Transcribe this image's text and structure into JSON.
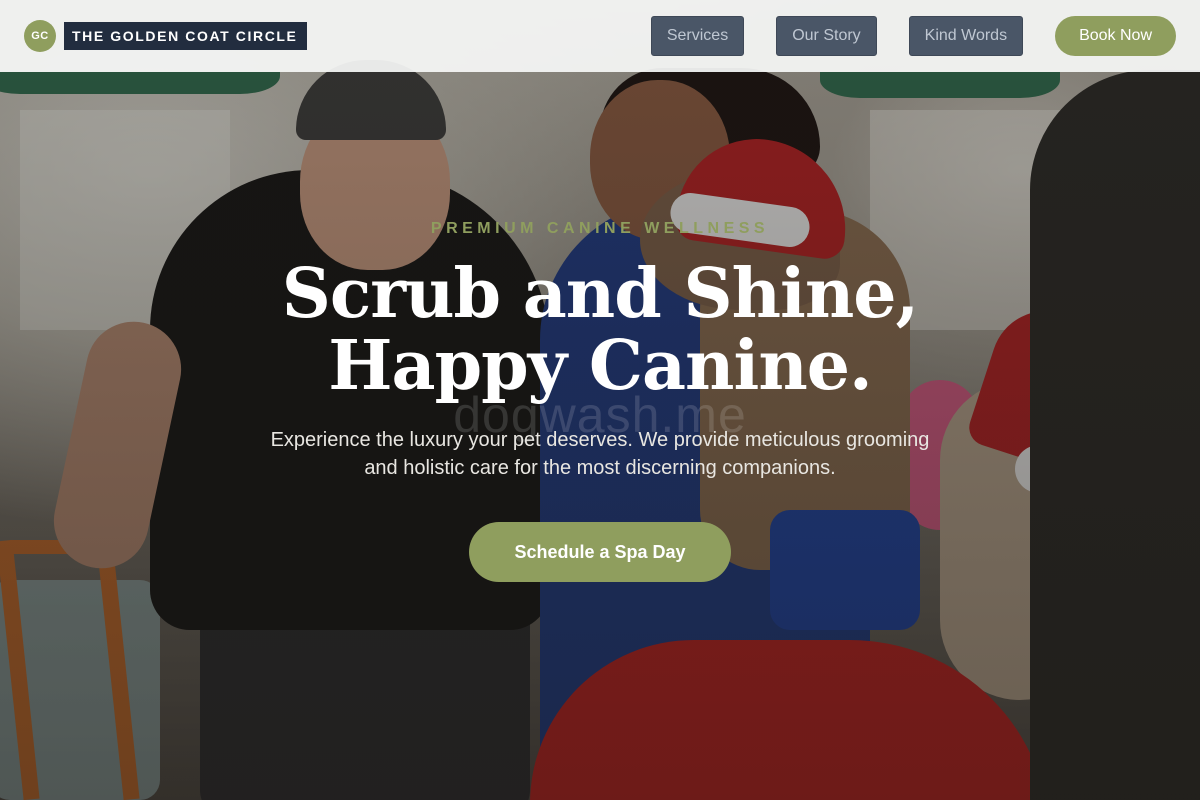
{
  "brand": {
    "initials": "GC",
    "name": "THE GOLDEN COAT CIRCLE"
  },
  "nav": {
    "items": [
      {
        "label": "Services"
      },
      {
        "label": "Our Story"
      },
      {
        "label": "Kind Words"
      }
    ],
    "cta_label": "Book Now"
  },
  "hero": {
    "eyebrow": "PREMIUM CANINE WELLNESS",
    "headline_line1": "Scrub and Shine,",
    "headline_line2": "Happy Canine.",
    "watermark": "dogwash.me",
    "subtext": "Experience the luxury your pet deserves. We provide meticulous grooming and holistic care for the most discerning companions.",
    "cta_label": "Schedule a Spa Day"
  },
  "colors": {
    "accent": "#8f9e5e",
    "brand_dark": "#222d3f",
    "nav_button": "#4a5667",
    "header_bg": "#f6f7f6"
  }
}
